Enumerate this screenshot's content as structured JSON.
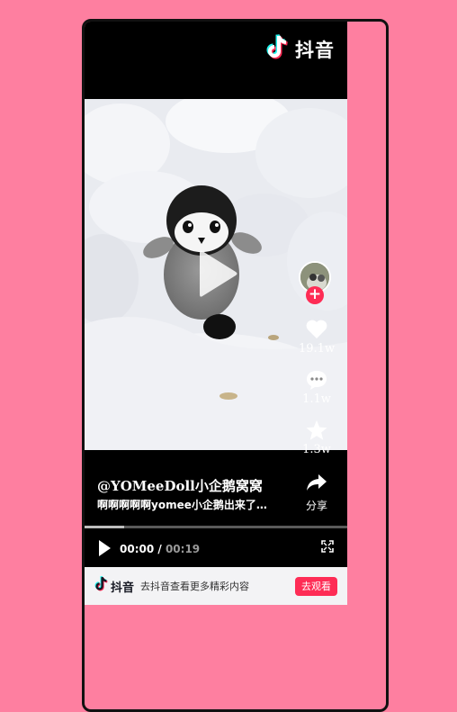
{
  "brand": {
    "name": "抖音",
    "icon": "tiktok-note-icon",
    "color": "#fe2c55",
    "accent_cyan": "#25f4ee"
  },
  "video": {
    "author": "@YOMeeDoll小企鹅窝窝",
    "caption": "啊啊啊啊啊yomee小企鹅出来了…",
    "likes": "19.1w",
    "comments": "1.1w",
    "favorites": "1.3w",
    "share_label": "分享",
    "progress": 0.15
  },
  "controls": {
    "current_time": "00:00",
    "separator": " / ",
    "duration": "00:19"
  },
  "banner": {
    "brand": "抖音",
    "text": "去抖音查看更多精彩内容",
    "button": "去观看"
  }
}
